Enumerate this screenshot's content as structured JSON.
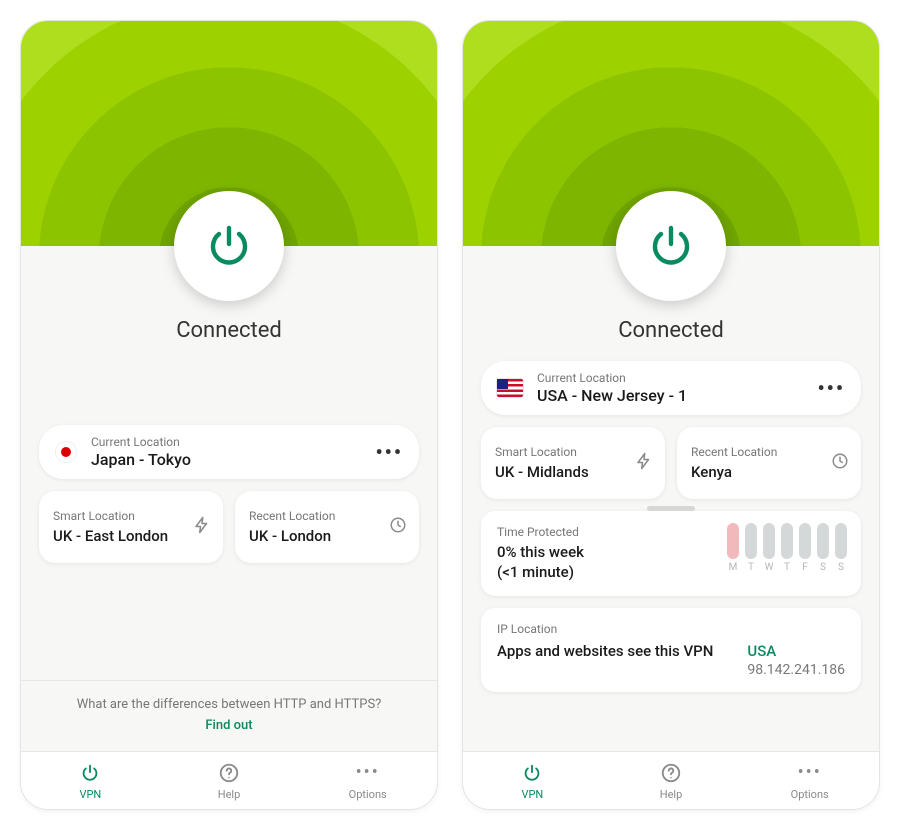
{
  "colors": {
    "accent": "#0a8a5f",
    "heroTop": "#aede1e"
  },
  "ios": {
    "status": "Connected",
    "current": {
      "label": "Current Location",
      "value": "Japan - Tokyo",
      "flag": "jp"
    },
    "smart": {
      "label": "Smart Location",
      "value": "UK - East London"
    },
    "recent": {
      "label": "Recent Location",
      "value": "UK - London"
    },
    "tip": {
      "question": "What are the differences between HTTP and HTTPS?",
      "link": "Find out"
    },
    "tabs": {
      "vpn": "VPN",
      "help": "Help",
      "options": "Options"
    }
  },
  "android": {
    "status": "Connected",
    "current": {
      "label": "Current Location",
      "value": "USA - New Jersey - 1",
      "flag": "us"
    },
    "smart": {
      "label": "Smart Location",
      "value": "UK - Midlands"
    },
    "recent": {
      "label": "Recent Location",
      "value": "Kenya"
    },
    "timeProtected": {
      "label": "Time Protected",
      "value": "0% this week\n(<1 minute)",
      "days": [
        "M",
        "T",
        "W",
        "T",
        "F",
        "S",
        "S"
      ],
      "todayIndex": 0
    },
    "ip": {
      "label": "IP Location",
      "value": "Apps and websites see this VPN",
      "country": "USA",
      "address": "98.142.241.186"
    },
    "tabs": {
      "vpn": "VPN",
      "help": "Help",
      "options": "Options"
    }
  }
}
